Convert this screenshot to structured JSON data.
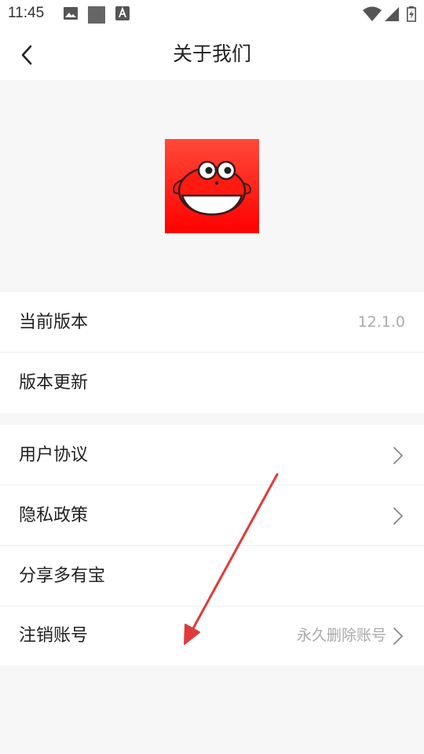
{
  "status_bar": {
    "time": "11:45",
    "icons": [
      "image-icon",
      "square-icon",
      "a-badge-icon",
      "wifi-icon",
      "signal-icon",
      "battery-charging-icon"
    ]
  },
  "nav": {
    "title": "关于我们",
    "back_icon": "chevron-left-icon"
  },
  "hero": {
    "logo_icon": "app-logo-fish-icon",
    "accent": "#ff1a10"
  },
  "sections": {
    "version": {
      "label": "当前版本",
      "value": "12.1.0"
    },
    "update": {
      "label": "版本更新"
    },
    "agreement": {
      "label": "用户协议"
    },
    "privacy": {
      "label": "隐私政策"
    },
    "share": {
      "label": "分享多有宝"
    },
    "cancel_account": {
      "label": "注销账号",
      "hint": "永久删除账号"
    }
  },
  "annotation": {
    "arrow_color": "#e03a3a"
  }
}
